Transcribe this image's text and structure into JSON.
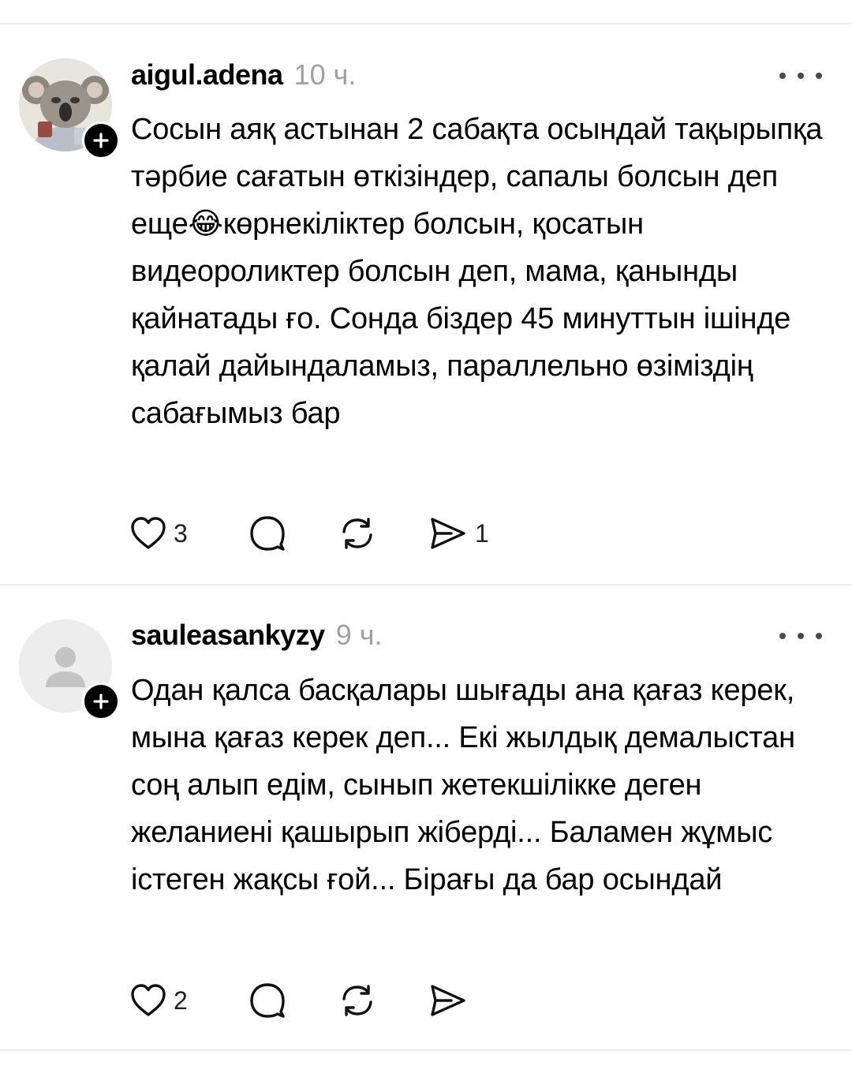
{
  "posts": [
    {
      "username": "aigul.adena",
      "time": "10 ч.",
      "avatar": "koala-avatar",
      "follow_icon": "plus-icon",
      "text": "Сосын аяқ астынан 2 сабақта осындай тақырыпқа тәрбие сағатын өткізіндер, сапалы болсын деп еще😂көрнекіліктер болсын, қосатын видеороликтер болсын деп, мама, қанынды қайнатады ғо. Сонда біздер 45 минуттын ішінде қалай дайындаламыз, параллельно өзіміздің сабағымыз бар",
      "likes": "3",
      "shares": "1"
    },
    {
      "username": "sauleasankyzy",
      "time": "9 ч.",
      "avatar": "default-user-avatar",
      "follow_icon": "plus-icon",
      "text": "Одан қалса басқалары  шығады ана қағаз керек, мына қағаз керек деп... Екі жылдық демалыстан  соң алып едім, сынып жетекшілікке деген желаниені қашырып жіберді... Баламен жұмыс істеген жақсы ғой... Бірағы да бар осындай",
      "likes": "2",
      "shares": ""
    }
  ],
  "icons": {
    "like": "heart-icon",
    "reply": "comment-bubble-icon",
    "repost": "repost-icon",
    "share": "send-icon",
    "more": "more-dots-icon"
  },
  "colors": {
    "text": "#000000",
    "timestamp": "#a0a0a0",
    "divider": "#ececec",
    "badge": "#000000"
  }
}
